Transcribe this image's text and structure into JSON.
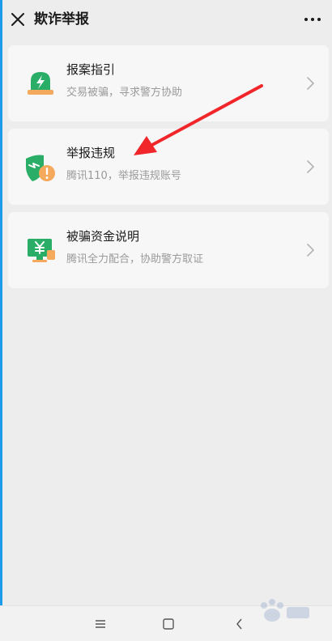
{
  "header": {
    "title": "欺诈举报",
    "close_icon": "close-icon",
    "more_icon": "more-dots-icon"
  },
  "cards": [
    {
      "title": "报案指引",
      "subtitle": "交易被骗，寻求警方协助",
      "icon": "alarm-light-icon"
    },
    {
      "title": "举报违规",
      "subtitle": "腾讯110，举报违规账号",
      "icon": "shield-warning-icon"
    },
    {
      "title": "被骗资金说明",
      "subtitle": "腾讯全力配合，协助警方取证",
      "icon": "money-screen-icon"
    }
  ],
  "navbar": {
    "menu_icon": "menu-icon",
    "home_icon": "square-icon",
    "back_icon": "back-icon"
  },
  "colors": {
    "accent_green": "#2aae67",
    "accent_orange": "#f4a95c",
    "annotation_red": "#f0262a",
    "background": "#ededed",
    "card": "#f7f7f7"
  }
}
